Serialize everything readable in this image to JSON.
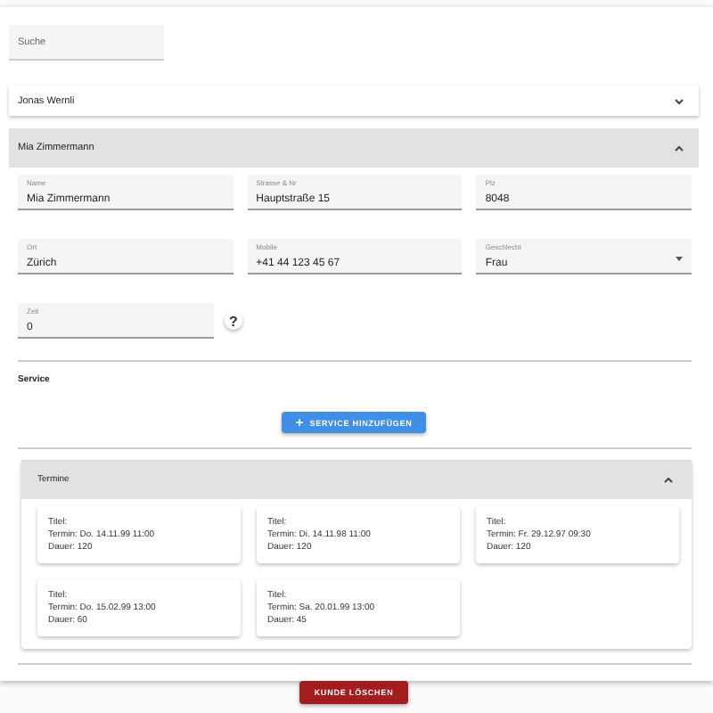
{
  "search": {
    "placeholder": "Suche"
  },
  "customers": [
    {
      "name": "Jonas Wernli",
      "expanded": false
    },
    {
      "name": "Mia Zimmermann",
      "expanded": true
    }
  ],
  "form": {
    "fields": [
      {
        "kind": "text",
        "label": "Name",
        "value": "Mia Zimmermann"
      },
      {
        "kind": "text",
        "label": "Strasse & Nr",
        "value": "Hauptstraße 15"
      },
      {
        "kind": "text",
        "label": "Plz",
        "value": "8048"
      },
      {
        "kind": "text",
        "label": "Ort",
        "value": "Zürich"
      },
      {
        "kind": "text",
        "label": "Mobile",
        "value": "+41 44 123 45 67"
      },
      {
        "kind": "select",
        "label": "Geschlecht",
        "value": "Frau"
      }
    ],
    "time_field": {
      "label": "Zeit",
      "value": "0"
    },
    "help": "?"
  },
  "service": {
    "title": "Service",
    "button": "SERVICE HINZUFÜGEN"
  },
  "appointments": {
    "title": "Termine",
    "expanded": true,
    "cards": [
      {
        "lines": [
          "Titel:",
          "Termin: Do. 14.11.99 11:00",
          "Dauer: 120"
        ]
      },
      {
        "lines": [
          "Titel:",
          "Termin: Di. 14.11.98 11:00",
          "Dauer: 120"
        ]
      },
      {
        "lines": [
          "Titel:",
          "Termin: Fr. 29.12.97 09:30",
          "Dauer: 120"
        ]
      },
      {
        "lines": [
          "Titel:",
          "Termin: Do. 15.02.99 13:00",
          "Dauer: 60"
        ]
      },
      {
        "lines": [
          "Titel:",
          "Termin: Sa. 20.01.99 13:00",
          "Dauer: 45"
        ]
      }
    ]
  },
  "delete_button": "KUNDE LÖSCHEN"
}
